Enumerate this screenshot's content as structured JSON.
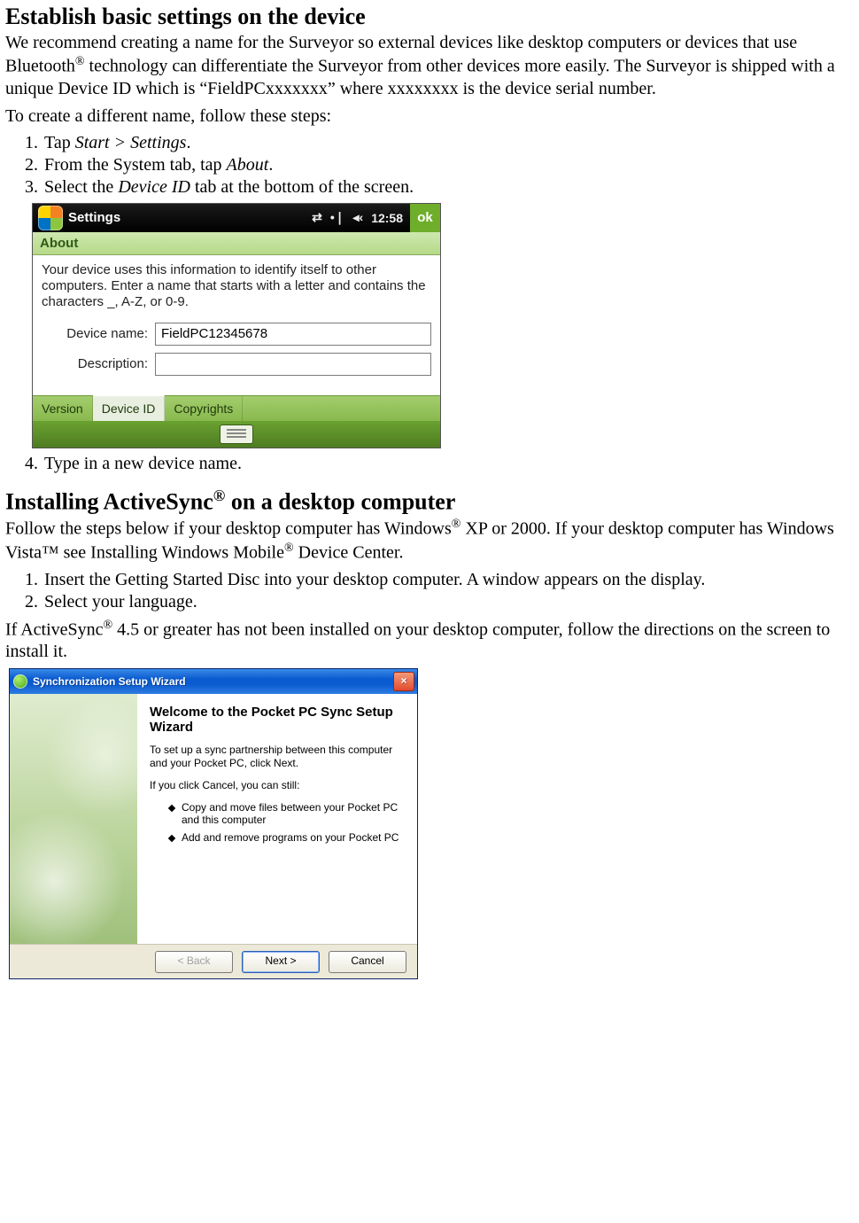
{
  "section1": {
    "heading": "Establish basic settings on the device",
    "para1_a": "We recommend creating a name for the Surveyor so external devices like desktop computers or devices that use Bluetooth",
    "para1_b": " technology can differentiate the Surveyor from other devices more easily. The Surveyor is shipped with a unique Device ID which is “FieldPCxxxxxxx” where xxxxxxxx is the device serial number.",
    "para2": "To create a different name, follow these steps:",
    "steps": {
      "s1_a": "Tap ",
      "s1_b": "Start > Settings",
      "s1_c": ".",
      "s2_a": "From the System tab, tap ",
      "s2_b": "About",
      "s2_c": ".",
      "s3_a": "Select the ",
      "s3_b": "Device ID",
      "s3_c": " tab at the bottom of the screen.",
      "s4": "Type in a new device name."
    }
  },
  "wm": {
    "title": "Settings",
    "clock": "12:58",
    "ok": "ok",
    "subhead": "About",
    "desc": "Your device uses this information to identify itself to other computers. Enter a name that starts with a letter and contains the characters _, A-Z, or 0-9.",
    "label_name": "Device name:",
    "value_name": "FieldPC12345678",
    "label_desc": "Description:",
    "value_desc": "",
    "tabs": {
      "t1": "Version",
      "t2": "Device ID",
      "t3": "Copyrights"
    },
    "tray": {
      "sync": "⇄",
      "signal": "•❘",
      "vol": "◂‹"
    }
  },
  "section2": {
    "heading_a": "Installing ActiveSync",
    "heading_b": " on a desktop computer",
    "para1_a": "Follow the steps below if your desktop computer has Windows",
    "para1_b": " XP or 2000. If your desktop computer has Windows Vista™ see Installing Windows Mobile",
    "para1_c": " Device Center.",
    "steps": {
      "s1": "Insert the Getting Started Disc into your desktop computer. A window appears on the display.",
      "s2": "Select your language."
    },
    "para2_a": "If ActiveSync",
    "para2_b": " 4.5 or greater has not been installed on your desktop computer, follow the directions on the screen to install it."
  },
  "xp": {
    "title": "Synchronization Setup Wizard",
    "heading": "Welcome to the Pocket PC Sync Setup Wizard",
    "p1": "To set up a sync partnership between this computer and your Pocket PC, click Next.",
    "p2": "If you click Cancel, you can still:",
    "b1": "Copy and move files between your Pocket PC and this computer",
    "b2": "Add and remove programs on your Pocket PC",
    "buttons": {
      "back": "< Back",
      "next": "Next >",
      "cancel": "Cancel"
    },
    "close": "×"
  },
  "reg": "®"
}
